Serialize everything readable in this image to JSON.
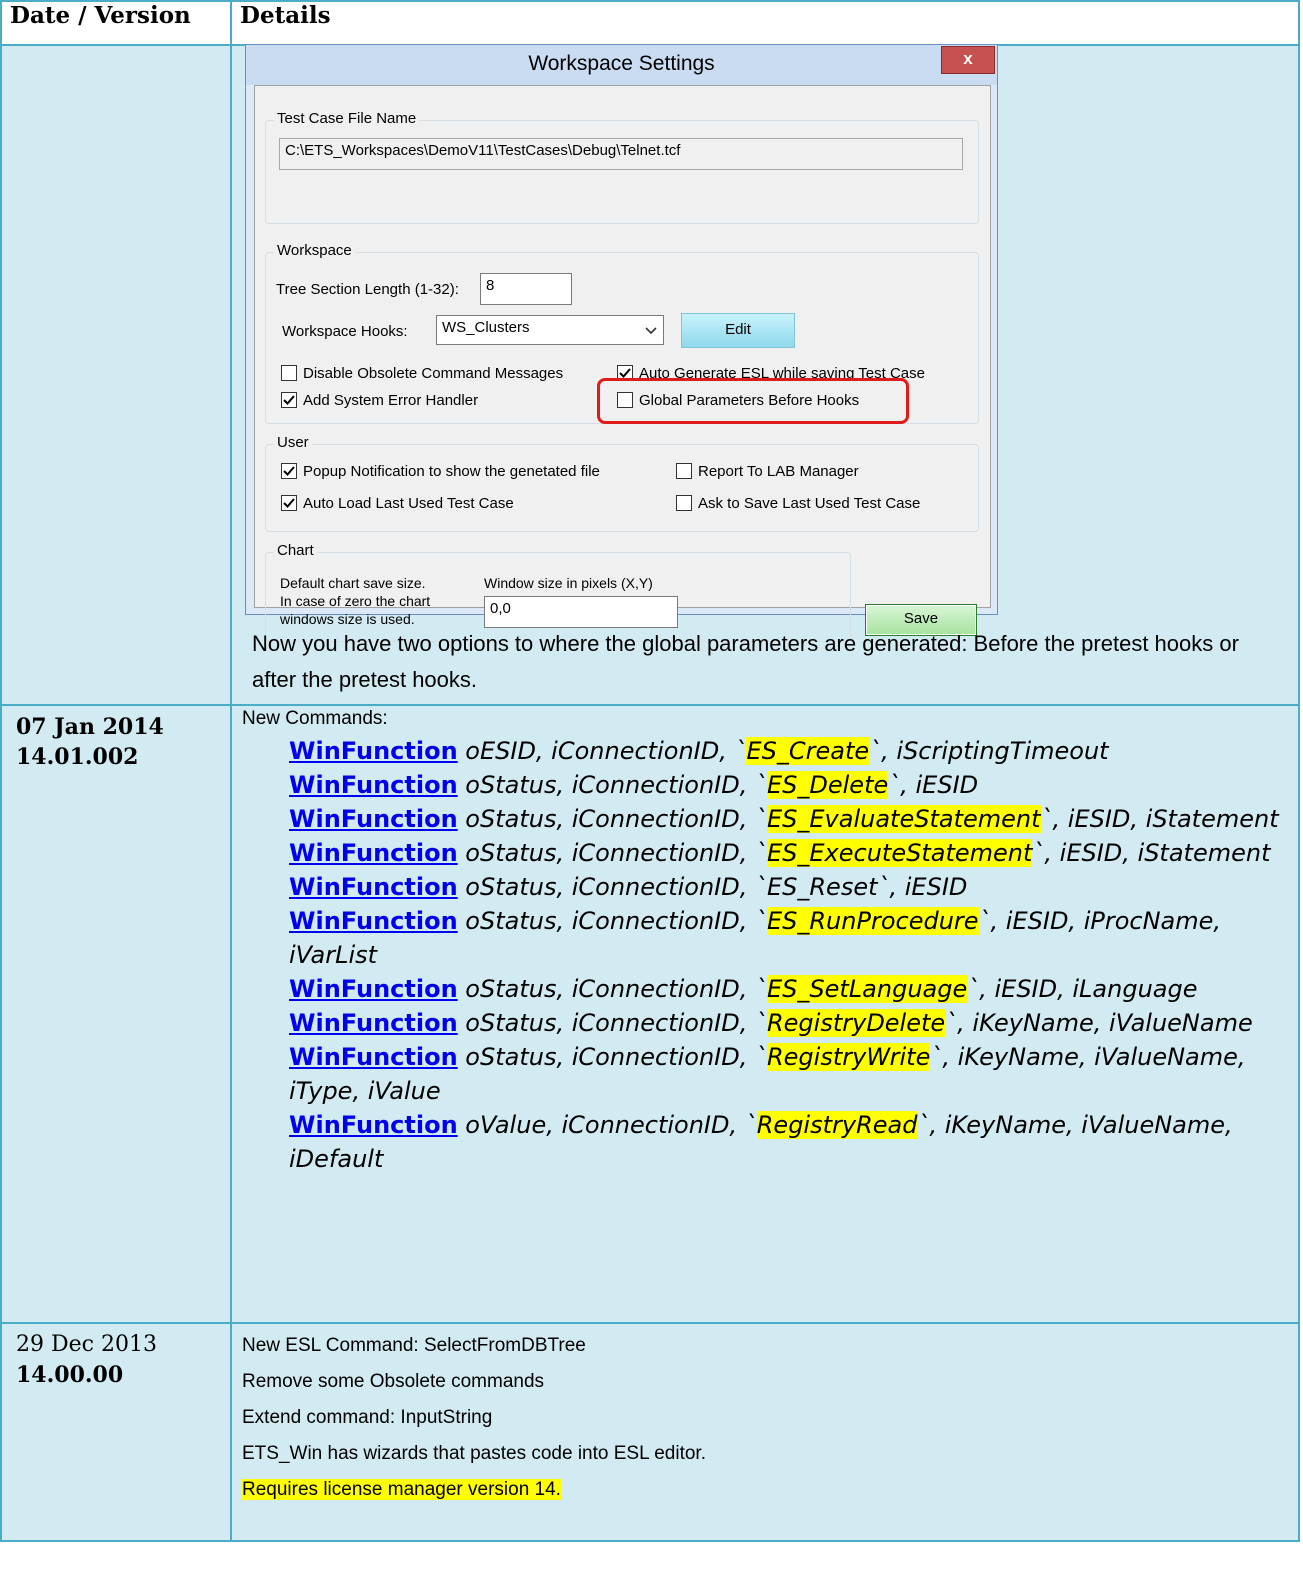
{
  "table": {
    "header_date": "Date / Version",
    "header_details": "Details"
  },
  "dialog": {
    "title": "Workspace Settings",
    "close_label": "x",
    "test_case_group": "Test Case File Name",
    "test_case_path": "C:\\ETS_Workspaces\\DemoV11\\TestCases\\Debug\\Telnet.tcf",
    "workspace_group": "Workspace",
    "tree_section_label": "Tree Section Length (1-32):",
    "tree_section_value": "8",
    "hooks_label": "Workspace Hooks:",
    "hooks_value": "WS_Clusters",
    "edit_label": "Edit",
    "disable_obsolete": "Disable Obsolete Command Messages",
    "auto_generate": "Auto Generate ESL while saving Test Case",
    "add_system_error": "Add System Error Handler",
    "global_params": "Global Parameters Before Hooks",
    "user_group": "User",
    "popup_notification": "Popup Notification to show the genetated file",
    "report_lab": "Report To LAB Manager",
    "auto_load": "Auto Load Last Used Test Case",
    "ask_save": "Ask to Save Last Used Test Case",
    "chart_group": "Chart",
    "chart_desc_1": "Default chart save size.",
    "chart_desc_2": "In case of zero the chart",
    "chart_desc_3": "windows size is used.",
    "window_size_label": "Window size in pixels (X,Y)",
    "window_size_value": "0,0",
    "save_label": "Save"
  },
  "row1_note": "Now you have two options to where the global parameters are generated: Before the pretest hooks or after the pretest hooks.",
  "row2": {
    "date": "07 Jan 2014",
    "version": "14.01.002",
    "heading": "New Commands:",
    "cmd_name": "WinFunction",
    "cmds": [
      {
        "a": " oESID, iConnectionID, `",
        "h": "ES_Create",
        "b": "`, iScriptingTimeout"
      },
      {
        "a": " oStatus, iConnectionID, `",
        "h": "ES_Delete",
        "b": "`, iESID"
      },
      {
        "a": " oStatus, iConnectionID, `",
        "h": "ES_EvaluateStatement",
        "b": "`, iESID, iStatement"
      },
      {
        "a": " oStatus, iConnectionID, `",
        "h": "ES_ExecuteStatement",
        "b": "`, iESID, iStatement"
      },
      {
        "a": " oStatus, iConnectionID, `ES_Reset`, iESID",
        "h": "",
        "b": ""
      },
      {
        "a": " oStatus, iConnectionID, `",
        "h": "ES_RunProcedure",
        "b": "`, iESID, iProcName, iVarList"
      },
      {
        "a": " oStatus, iConnectionID, `",
        "h": "ES_SetLanguage",
        "b": "`, iESID, iLanguage"
      },
      {
        "a": " oStatus, iConnectionID, `",
        "h": "RegistryDelete",
        "b": "`, iKeyName, iValueName"
      },
      {
        "a": " oStatus, iConnectionID, `",
        "h": "RegistryWrite",
        "b": "`, iKeyName, iValueName, iType, iValue"
      },
      {
        "a": " oValue, iConnectionID, `",
        "h": "RegistryRead",
        "b": "`, iKeyName, iValueName, iDefault"
      }
    ]
  },
  "row3": {
    "date": "29 Dec 2013",
    "version": "14.00.00",
    "lines": [
      "New ESL Command: SelectFromDBTree",
      "Remove some Obsolete commands",
      "Extend command: InputString",
      "ETS_Win has wizards that pastes code into ESL editor."
    ],
    "highlight_line": "Requires license manager version 14."
  },
  "colors": {
    "border": "#4bacc6",
    "cell_bg": "#d2eaf1",
    "highlight": "#ffff00",
    "link": "#0000ee",
    "callout": "#e01b1b"
  }
}
